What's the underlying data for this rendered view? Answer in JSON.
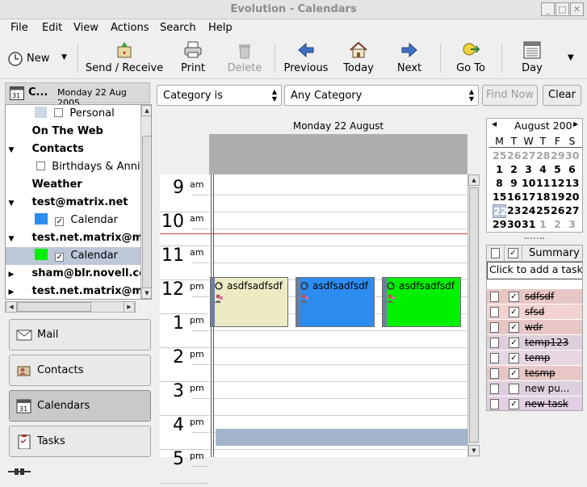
{
  "window": {
    "title": "Evolution - Calendars"
  },
  "menu": [
    "File",
    "Edit",
    "View",
    "Actions",
    "Search",
    "Help"
  ],
  "toolbar": {
    "new": "New",
    "send_receive": "Send / Receive",
    "print": "Print",
    "delete": "Delete",
    "previous": "Previous",
    "today": "Today",
    "next": "Next",
    "goto": "Go To",
    "day": "Day"
  },
  "sidebar": {
    "header_title": "C...",
    "header_date": "Monday 22 Aug 2005",
    "tree": [
      {
        "label": "Personal",
        "type": "cal"
      },
      {
        "label": "On The Web",
        "type": "group"
      },
      {
        "label": "Contacts",
        "type": "group"
      },
      {
        "label": "Birthdays & Annive",
        "type": "cal"
      },
      {
        "label": "Weather",
        "type": "group"
      },
      {
        "label": "test@matrix.net",
        "type": "group"
      },
      {
        "label": "Calendar",
        "type": "cal"
      },
      {
        "label": "test.net.matrix@matri",
        "type": "group"
      },
      {
        "label": "Calendar",
        "type": "cal"
      },
      {
        "label": "sham@blr.novell.com",
        "type": "group"
      },
      {
        "label": "test.net.matrix@matri",
        "type": "group"
      }
    ],
    "nav": [
      "Mail",
      "Contacts",
      "Calendars",
      "Tasks"
    ]
  },
  "filter": {
    "field": "Category is",
    "value": "Any Category",
    "find_now": "Find Now",
    "clear": "Clear"
  },
  "dayview": {
    "header": "Monday 22 August",
    "hours": [
      {
        "h": "9",
        "ap": "am"
      },
      {
        "h": "10",
        "ap": "am"
      },
      {
        "h": "11",
        "ap": "am"
      },
      {
        "h": "12",
        "ap": "pm"
      },
      {
        "h": "1",
        "ap": "pm"
      },
      {
        "h": "2",
        "ap": "pm"
      },
      {
        "h": "3",
        "ap": "pm"
      },
      {
        "h": "4",
        "ap": "pm"
      },
      {
        "h": "5",
        "ap": "pm"
      }
    ],
    "events": [
      {
        "title": "asdfsadfsdf",
        "color": "#ecebc4"
      },
      {
        "title": "asdfsadfsdf",
        "color": "#2d8cf0"
      },
      {
        "title": "asdfsadfsdf",
        "color": "#00f000"
      }
    ]
  },
  "minical": {
    "month": "August 200",
    "weekdays": [
      "M",
      "T",
      "W",
      "T",
      "F",
      "S"
    ],
    "weeks": [
      [
        "25",
        "26",
        "27",
        "28",
        "29",
        "30"
      ],
      [
        "1",
        "2",
        "3",
        "4",
        "5",
        "6"
      ],
      [
        "8",
        "9",
        "10",
        "11",
        "12",
        "13"
      ],
      [
        "15",
        "16",
        "17",
        "18",
        "19",
        "20"
      ],
      [
        "22",
        "23",
        "24",
        "25",
        "26",
        "27"
      ],
      [
        "29",
        "30",
        "31",
        "1",
        "2",
        "3"
      ]
    ],
    "selected": "22"
  },
  "tasks": {
    "summary_header": "Summary",
    "add_placeholder": "Click to add a task",
    "items": [
      {
        "summary": "sdfsdf",
        "done": true
      },
      {
        "summary": "sfsd",
        "done": true
      },
      {
        "summary": "wdr",
        "done": true
      },
      {
        "summary": "temp123",
        "done": true
      },
      {
        "summary": "temp",
        "done": true
      },
      {
        "summary": "tesmp",
        "done": true
      },
      {
        "summary": "new pu...",
        "done": false
      },
      {
        "summary": "new task",
        "done": true
      }
    ]
  },
  "colors": {
    "calendar_blue": "#2d8cf0",
    "calendar_green": "#00f000",
    "allday_bg": "#aeaeae",
    "selection": "#bcc7d8"
  }
}
